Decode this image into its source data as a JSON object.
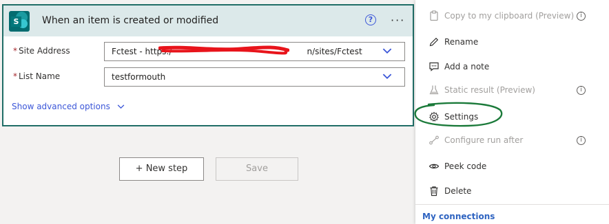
{
  "trigger_card": {
    "title": "When an item is created or modified",
    "help_icon": "?",
    "more_icon": "···",
    "fields": [
      {
        "label": "Site Address",
        "required_mark": "*",
        "value_prefix": "Fctest - https:/",
        "value_suffix": "n/sites/Fctest"
      },
      {
        "label": "List Name",
        "required_mark": "*",
        "value": "testformouth"
      }
    ],
    "show_advanced_label": "Show advanced options"
  },
  "buttons": {
    "new_step": "+ New step",
    "save": "Save"
  },
  "context_menu": {
    "items": [
      {
        "label": "Copy to my clipboard (Preview)",
        "icon": "clipboard-icon",
        "disabled": true,
        "info": true
      },
      {
        "label": "Rename",
        "icon": "pencil-icon",
        "disabled": false,
        "info": false
      },
      {
        "label": "Add a note",
        "icon": "note-icon",
        "disabled": false,
        "info": false
      },
      {
        "label": "Static result (Preview)",
        "icon": "flask-icon",
        "disabled": true,
        "info": true
      },
      {
        "label": "Settings",
        "icon": "gear-icon",
        "disabled": false,
        "info": false
      },
      {
        "label": "Configure run after",
        "icon": "run-after-icon",
        "disabled": true,
        "info": true
      },
      {
        "label": "Peek code",
        "icon": "eye-icon",
        "disabled": false,
        "info": false
      },
      {
        "label": "Delete",
        "icon": "trash-icon",
        "disabled": false,
        "info": false
      }
    ],
    "info_glyph": "i",
    "my_connections": "My connections"
  },
  "colors": {
    "card_border": "#1f6d66",
    "header_bg": "#dce9ea",
    "link_blue": "#3b56d8",
    "annotation_green": "#1b7a3a",
    "redaction_red": "#e8141b"
  }
}
